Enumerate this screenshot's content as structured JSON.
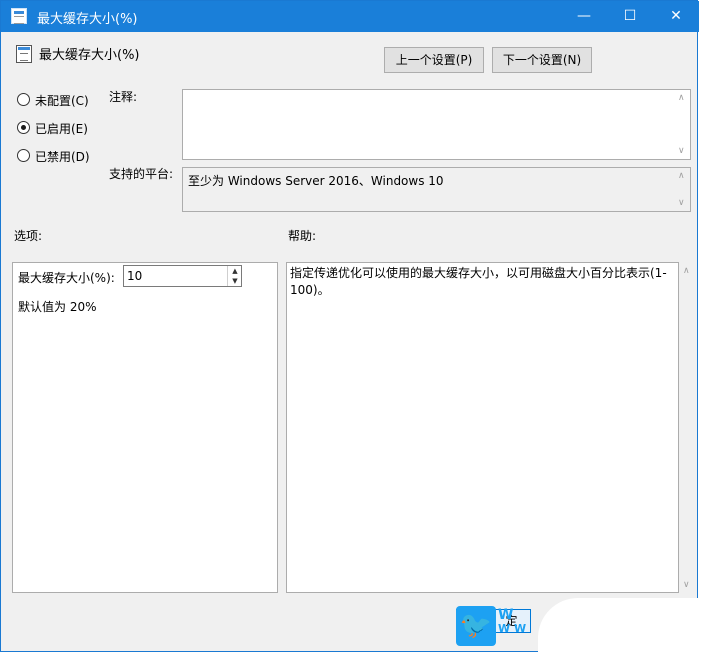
{
  "window": {
    "title": "最大缓存大小(%)",
    "controls": {
      "minimize": "—",
      "maximize": "☐",
      "close": "✕"
    }
  },
  "header": {
    "policy_name": "最大缓存大小(%)",
    "prev_button": "上一个设置(P)",
    "next_button": "下一个设置(N)"
  },
  "state": {
    "options": [
      {
        "label": "未配置(C)",
        "selected": false
      },
      {
        "label": "已启用(E)",
        "selected": true
      },
      {
        "label": "已禁用(D)",
        "selected": false
      }
    ]
  },
  "comment": {
    "label": "注释:",
    "value": ""
  },
  "platform": {
    "label": "支持的平台:",
    "value": "至少为 Windows Server 2016、Windows 10"
  },
  "options_pane": {
    "title": "选项:",
    "field_label": "最大缓存大小(%):",
    "field_value": "10",
    "default_text": "默认值为 20%"
  },
  "help_pane": {
    "title": "帮助:",
    "text": "指定传递优化可以使用的最大缓存大小，以可用磁盘大小百分比表示(1-100)。"
  },
  "footer": {
    "ok_fragment": "定"
  },
  "watermark": {
    "letter": "W",
    "dots": "W W"
  },
  "colors": {
    "titlebar": "#1a7fd9",
    "watermark": "#1da1f2"
  }
}
